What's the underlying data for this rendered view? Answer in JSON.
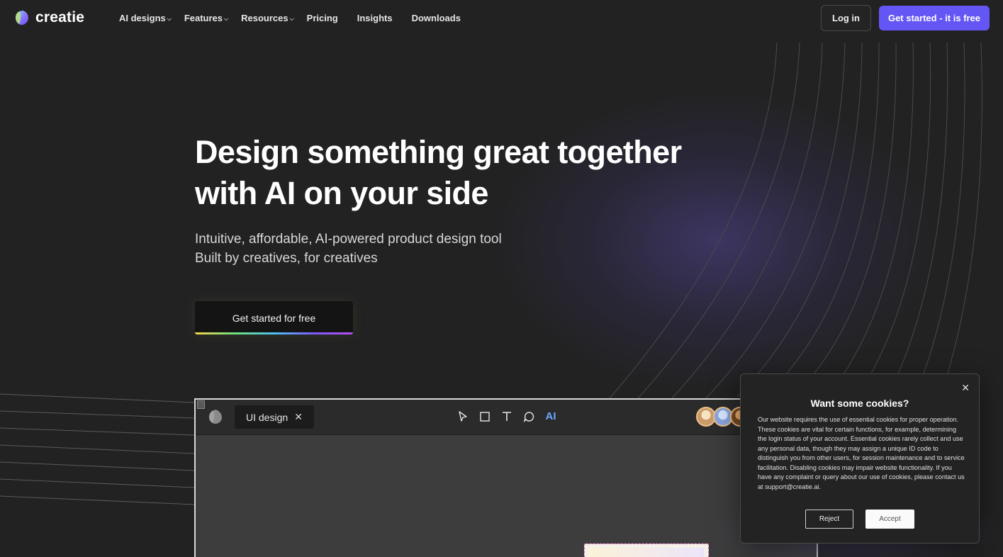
{
  "brand": {
    "name": "creatie"
  },
  "nav": {
    "items": [
      {
        "label": "AI designs",
        "dropdown": true
      },
      {
        "label": "Features",
        "dropdown": true
      },
      {
        "label": "Resources",
        "dropdown": true
      },
      {
        "label": "Pricing",
        "dropdown": false
      },
      {
        "label": "Insights",
        "dropdown": false
      },
      {
        "label": "Downloads",
        "dropdown": false
      }
    ],
    "login_label": "Log in",
    "cta_label": "Get started - it is free"
  },
  "hero": {
    "title_line1": "Design something great together",
    "title_line2": "with AI on your side",
    "subtitle_line1": "Intuitive, affordable, AI-powered product design tool",
    "subtitle_line2": "Built by creatives, for creatives",
    "cta_label": "Get started for free"
  },
  "editor": {
    "tab_label": "UI design",
    "tab_close": "✕",
    "tools": [
      "pointer-tool",
      "rectangle-tool",
      "text-tool",
      "comment-tool"
    ],
    "ai_tool_label": "AI"
  },
  "cookie": {
    "title": "Want some cookies?",
    "close": "✕",
    "body": "Our website requires the use of essential cookies for proper operation. These cookies are vital for certain functions, for example, determining the login status of your account. Essential cookies rarely collect and use any personal data, though they may assign a unique ID code to distinguish you from other users, for session maintenance and to service facilitation. Disabling cookies may impair website functionality. If you have any complaint or query about our use of cookies, please contact us at support@creatie.ai.",
    "reject_label": "Reject",
    "accept_label": "Accept"
  },
  "colors": {
    "background": "#222222",
    "accent": "#6455f5",
    "ai_blue": "#6aa8ff"
  }
}
